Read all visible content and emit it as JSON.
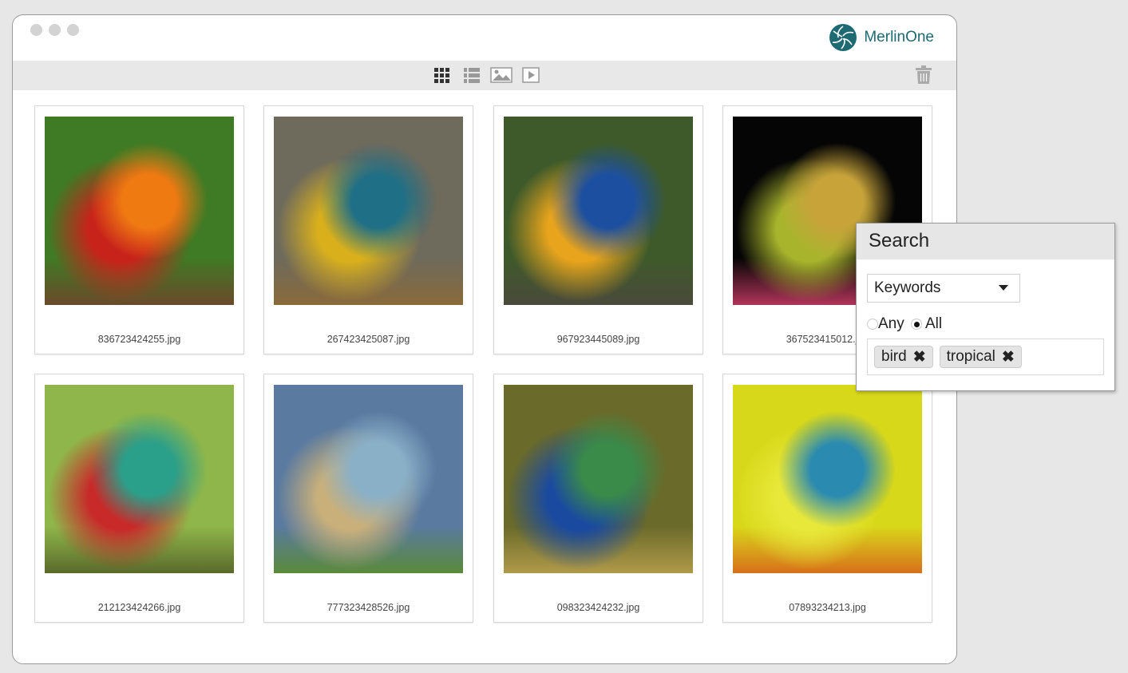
{
  "brand": {
    "name": "MerlinOne",
    "color": "#1e6a72"
  },
  "toolbar": {
    "icons": [
      "grid-view-icon",
      "list-view-icon",
      "image-filter-icon",
      "video-filter-icon",
      "trash-icon"
    ]
  },
  "assets": [
    {
      "filename": "836723424255.jpg",
      "colors": [
        "#3f7a24",
        "#c8231b",
        "#f07a12",
        "#6b4a2a"
      ]
    },
    {
      "filename": "267423425087.jpg",
      "colors": [
        "#6e6a5c",
        "#d9b01c",
        "#1f6f86",
        "#8a6a3a"
      ]
    },
    {
      "filename": "967923445089.jpg",
      "colors": [
        "#3e5a2a",
        "#e8a41c",
        "#1c4fa0",
        "#4a4a3a"
      ]
    },
    {
      "filename": "367523415012.jpg",
      "colors": [
        "#050505",
        "#a8b52c",
        "#c7a33a",
        "#b0345a"
      ]
    },
    {
      "filename": "212123424266.jpg",
      "colors": [
        "#8fb64a",
        "#c82a2a",
        "#2aa08a",
        "#5a6a2a"
      ]
    },
    {
      "filename": "777323428526.jpg",
      "colors": [
        "#5a7aa0",
        "#c9b07a",
        "#8ab0c8",
        "#5a8a3a"
      ]
    },
    {
      "filename": "098323424232.jpg",
      "colors": [
        "#6a6a2a",
        "#1a4aa0",
        "#3a8a4a",
        "#b09a4a"
      ]
    },
    {
      "filename": "07893234213.jpg",
      "colors": [
        "#d8d81a",
        "#e8e83a",
        "#2a8ab0",
        "#d8701a"
      ]
    }
  ],
  "search": {
    "title": "Search",
    "field": "Keywords",
    "match_any": "Any",
    "match_all": "All",
    "selected": "All",
    "tags": [
      {
        "label": "bird"
      },
      {
        "label": "tropical"
      }
    ],
    "remove_glyph": "✖"
  }
}
